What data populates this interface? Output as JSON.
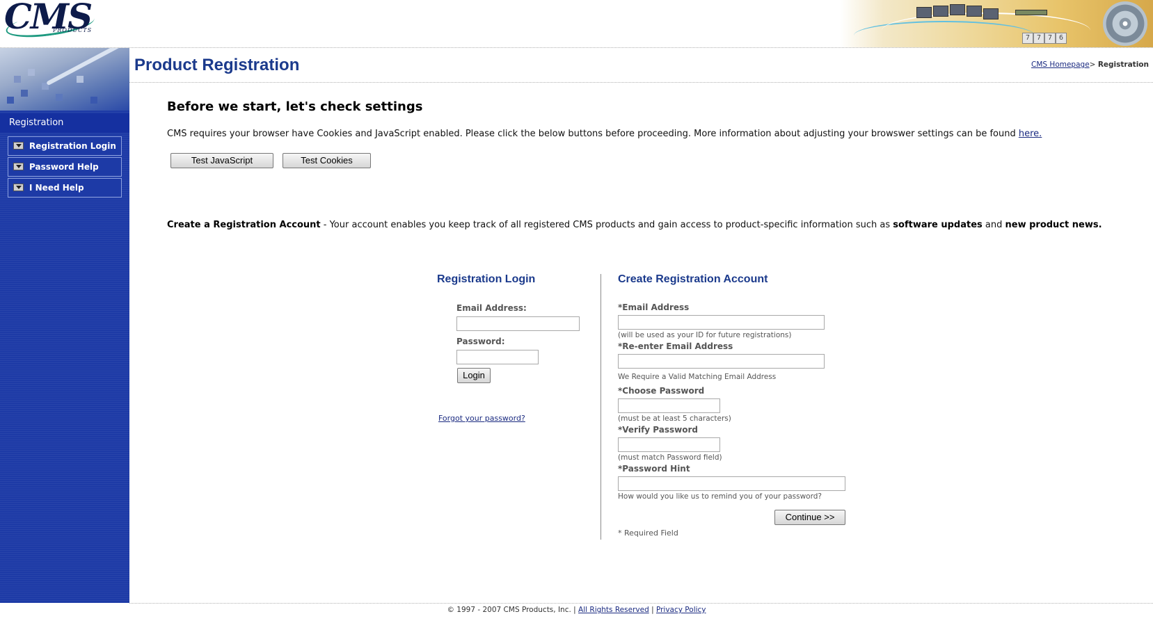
{
  "header": {
    "logo_text": "CMS",
    "logo_subtext": "PRODUCTS",
    "banner_digits": [
      "7",
      "7",
      "7",
      "6"
    ]
  },
  "sidebar": {
    "section_title": "Registration",
    "items": [
      {
        "label": "Registration Login"
      },
      {
        "label": "Password Help"
      },
      {
        "label": "I Need Help"
      }
    ]
  },
  "page": {
    "title": "Product Registration",
    "breadcrumb": {
      "home_link": "CMS Homepage",
      "separator": ">",
      "current": "Registration"
    }
  },
  "settings_check": {
    "heading": "Before we start, let's check settings",
    "text": "CMS requires your browser have Cookies and JavaScript enabled. Please click the below buttons before proceeding. More information about adjusting your browswer settings can be found ",
    "link": "here.",
    "test_js_label": "Test JavaScript",
    "test_cookies_label": "Test Cookies"
  },
  "intro": {
    "bold_lead": "Create a Registration Account",
    "text_1": " - Your account enables you keep track of all registered CMS products and gain access to product-specific information such as ",
    "bold_1": "software updates",
    "text_2": " and ",
    "bold_2": "new product news."
  },
  "login": {
    "heading": "Registration Login",
    "email_label": "Email Address:",
    "email_value": "",
    "password_label": "Password:",
    "password_value": "",
    "login_button": "Login",
    "forgot_link": "Forgot your password?"
  },
  "create": {
    "heading": "Create Registration Account",
    "email_label": "*Email Address",
    "email_hint": "(will be used as your ID for future registrations)",
    "reenter_label": "*Re-enter Email Address",
    "reenter_hint": "We Require a Valid Matching Email Address",
    "choose_pw_label": "*Choose Password",
    "choose_pw_hint": "(must be at least 5 characters)",
    "verify_pw_label": "*Verify Password",
    "verify_pw_hint": "(must match Password field)",
    "pw_hint_label": "*Password Hint",
    "pw_hint_hint": "How would you like us to remind you of your password?",
    "continue_button": "Continue >>",
    "required_note": "* Required Field"
  },
  "footer": {
    "copyright": "© 1997 - 2007 CMS Products, Inc. | ",
    "rights_link": "All Rights Reserved",
    "separator": " | ",
    "privacy_link": "Privacy Policy"
  }
}
